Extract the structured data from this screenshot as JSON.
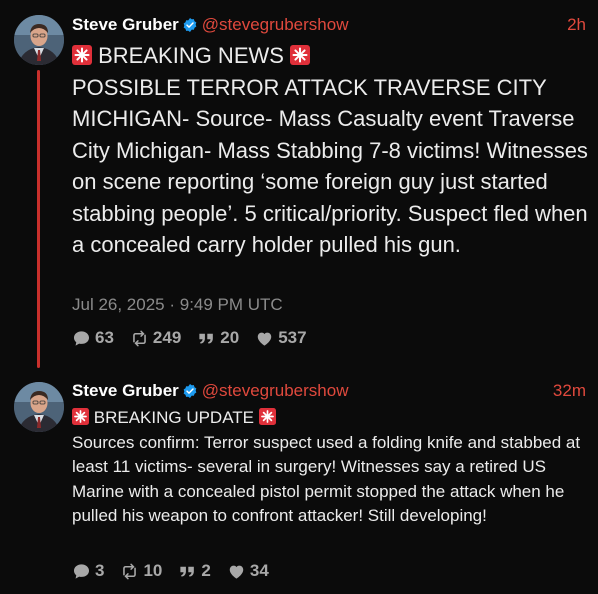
{
  "posts": [
    {
      "author": {
        "display_name": "Steve Gruber",
        "handle": "@stevegrubershow",
        "verified": true,
        "avatar": "profile-photo"
      },
      "time_ago": "2h",
      "headline": "BREAKING NEWS",
      "body": "POSSIBLE TERROR ATTACK TRAVERSE CITY MICHIGAN- Source- Mass Casualty event Traverse City Michigan- Mass Stabbing 7-8 victims! Witnesses on scene reporting ‘some foreign guy just started stabbing people’. 5 critical/priority. Suspect fled when a concealed carry holder pulled his gun.",
      "timestamp": "Jul 26, 2025 · 9:49 PM UTC",
      "stats": {
        "replies": "63",
        "reposts": "249",
        "quotes": "20",
        "likes": "537"
      }
    },
    {
      "author": {
        "display_name": "Steve Gruber",
        "handle": "@stevegrubershow",
        "verified": true,
        "avatar": "profile-photo"
      },
      "time_ago": "32m",
      "headline": "BREAKING UPDATE",
      "body": "Sources confirm: Terror suspect used a folding knife and stabbed at least 11 victims- several in surgery! Witnesses say a retired US Marine with a concealed pistol permit stopped the attack when he pulled his weapon to confront attacker! Still developing!",
      "stats": {
        "replies": "3",
        "reposts": "10",
        "quotes": "2",
        "likes": "34"
      }
    }
  ],
  "icons": {
    "headline_emoji": "siren-icon",
    "verified": "verified-badge-icon",
    "replies": "comment-icon",
    "reposts": "repost-icon",
    "quotes": "quote-icon",
    "likes": "heart-icon"
  },
  "colors": {
    "background": "#0b0b0b",
    "accent": "#e0493d",
    "thread_line": "#c9302c",
    "text": "#ececec",
    "muted": "#8b8b8b",
    "verified": "#1d9bf0"
  }
}
